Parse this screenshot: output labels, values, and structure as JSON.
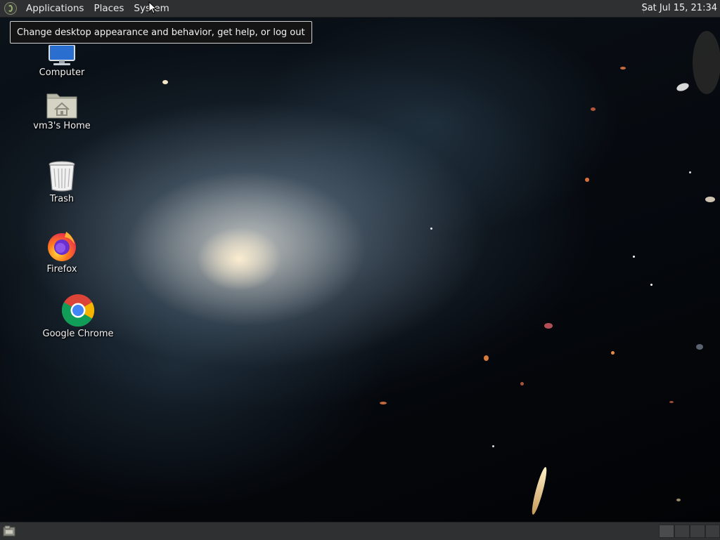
{
  "top_panel": {
    "menus": [
      "Applications",
      "Places",
      "System"
    ],
    "clock": "Sat Jul 15, 21:34",
    "logo_icon": "distro-logo-icon"
  },
  "tooltip": {
    "text": "Change desktop appearance and behavior, get help, or log out"
  },
  "desktop": {
    "icons": [
      {
        "label": "Computer",
        "icon": "computer-icon"
      },
      {
        "label": "vm3's Home",
        "icon": "home-folder-icon"
      },
      {
        "label": "Trash",
        "icon": "trash-icon"
      },
      {
        "label": "Firefox",
        "icon": "firefox-icon"
      },
      {
        "label": "Google Chrome",
        "icon": "chrome-icon"
      }
    ]
  },
  "bottom_panel": {
    "show_desktop_icon": "show-desktop-icon",
    "workspaces": 4
  },
  "colors": {
    "panel_bg": "#2f3032",
    "tooltip_bg": "#141414",
    "tooltip_border": "#d0d0d0"
  }
}
